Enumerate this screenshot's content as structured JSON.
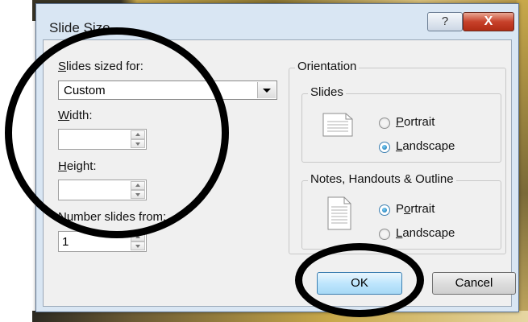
{
  "dialog": {
    "title": "Slide Size",
    "help_label": "?",
    "close_label": "X"
  },
  "left": {
    "sized_for_label_u": "S",
    "sized_for_label_rest": "lides sized for:",
    "sized_for_value": "Custom",
    "width_label_u": "W",
    "width_label_rest": "idth:",
    "width_value": "",
    "height_label_u": "H",
    "height_label_rest": "eight:",
    "height_value": "",
    "number_label": "Number slides from:",
    "number_value": "1"
  },
  "orientation": {
    "label": "Orientation",
    "slides": {
      "label": "Slides",
      "portrait_u": "P",
      "portrait_rest": "ortrait",
      "landscape_u": "L",
      "landscape_rest": "andscape",
      "selected": "landscape"
    },
    "notes": {
      "label": "Notes, Handouts & Outline",
      "portrait_pre": "P",
      "portrait_u": "o",
      "portrait_rest": "rtrait",
      "landscape_u": "L",
      "landscape_rest": "andscape",
      "selected": "portrait"
    }
  },
  "buttons": {
    "ok": "OK",
    "cancel": "Cancel"
  },
  "colors": {
    "dialog_frame": "#d9e6f3",
    "content_bg": "#f0f0f0",
    "close_button": "#c7412a",
    "default_button": "#bee6fd",
    "annotation": "#000000"
  }
}
